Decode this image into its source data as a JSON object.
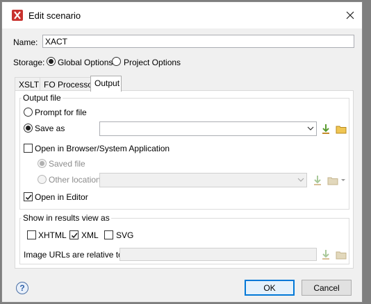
{
  "window": {
    "title": "Edit scenario",
    "icon": "oxygen-app-icon",
    "accent": "#0078d7"
  },
  "name": {
    "label": "Name:",
    "value": "XACT"
  },
  "storage": {
    "label": "Storage:",
    "options": [
      "Global Options",
      "Project Options"
    ],
    "selected": "Global Options"
  },
  "tabs": [
    {
      "label": "XSLT",
      "active": false
    },
    {
      "label": "FO Processor",
      "active": false
    },
    {
      "label": "Output",
      "active": true
    }
  ],
  "output_file": {
    "group_title": "Output file",
    "prompt_label": "Prompt for file",
    "save_as_label": "Save as",
    "save_as_value": "",
    "open_browser_label": "Open in Browser/System Application",
    "open_browser_checked": false,
    "saved_file_label": "Saved file",
    "other_location_label": "Other location",
    "other_location_value": "",
    "open_editor_label": "Open in Editor",
    "open_editor_checked": true
  },
  "results_view": {
    "group_title": "Show in results view as",
    "xhtml_label": "XHTML",
    "xhtml_checked": false,
    "xml_label": "XML",
    "xml_checked": true,
    "svg_label": "SVG",
    "svg_checked": false,
    "image_urls_label": "Image URLs are relative to:",
    "image_urls_value": ""
  },
  "footer": {
    "help": "?",
    "ok_label": "OK",
    "cancel_label": "Cancel"
  }
}
